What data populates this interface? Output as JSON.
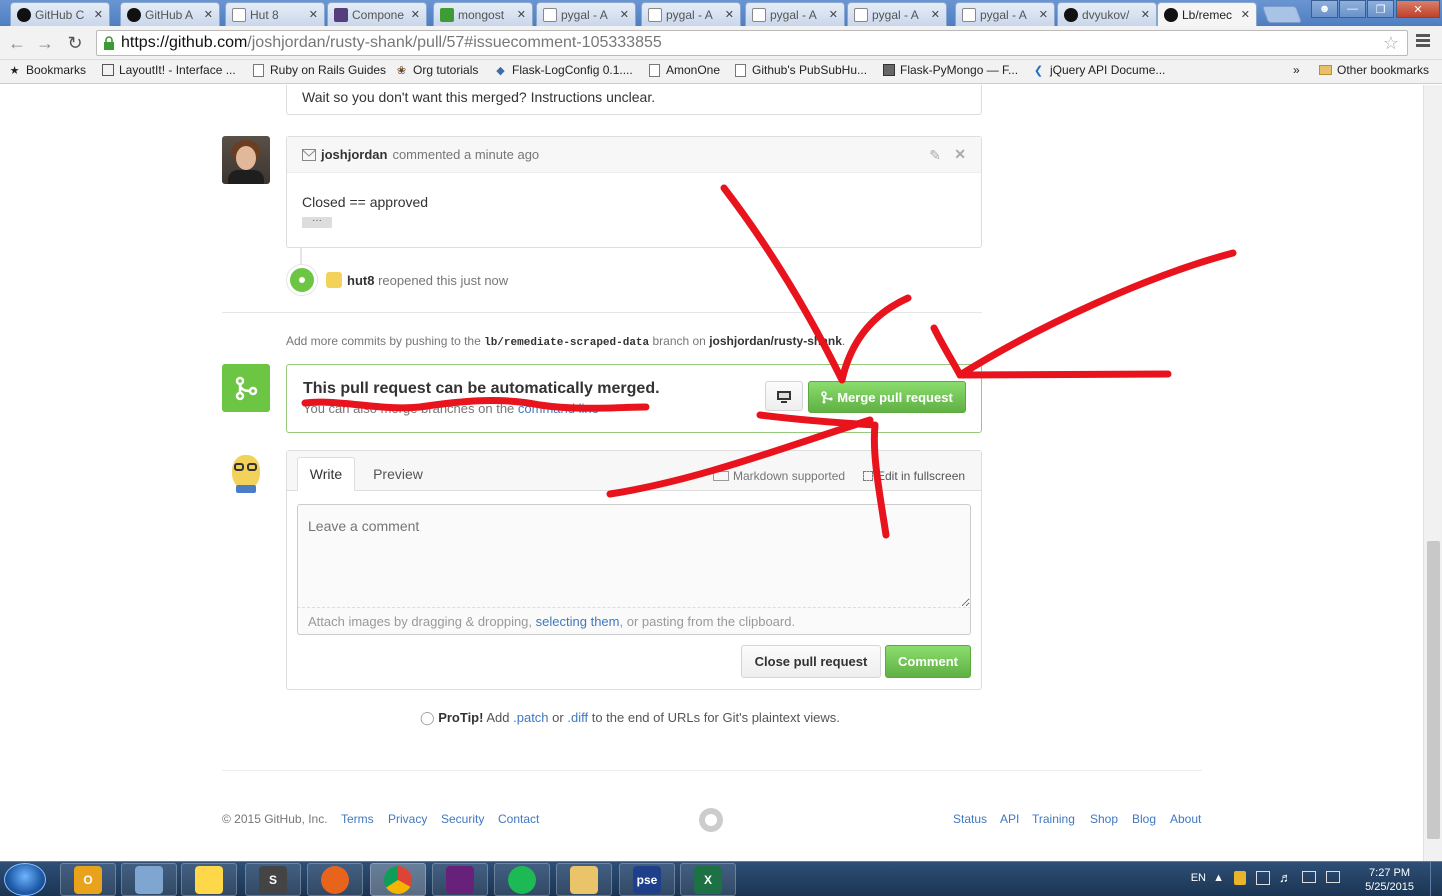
{
  "browser": {
    "tabs": [
      {
        "label": "GitHub C",
        "icon": "github-icon"
      },
      {
        "label": "GitHub A",
        "icon": "github-icon"
      },
      {
        "label": "Hut 8",
        "icon": "page-icon"
      },
      {
        "label": "Compone",
        "icon": "bootstrap-icon"
      },
      {
        "label": "mongost",
        "icon": "mongodb-icon"
      },
      {
        "label": "pygal - A",
        "icon": "page-icon"
      },
      {
        "label": "pygal - A",
        "icon": "page-icon"
      },
      {
        "label": "pygal - A",
        "icon": "page-icon"
      },
      {
        "label": "pygal - A",
        "icon": "page-icon"
      },
      {
        "label": "pygal - A",
        "icon": "page-icon"
      },
      {
        "label": "dvyukov/",
        "icon": "github-icon"
      },
      {
        "label": "Lb/remec",
        "icon": "github-icon"
      }
    ],
    "url_host": "https://github.com",
    "url_rest": "/joshjordan/rusty-shank/pull/57#issuecomment-105333855",
    "bookmarks": [
      {
        "label": "Bookmarks"
      },
      {
        "label": "LayoutIt! - Interface ..."
      },
      {
        "label": "Ruby on Rails Guides"
      },
      {
        "label": "Org tutorials"
      },
      {
        "label": "Flask-LogConfig 0.1...."
      },
      {
        "label": "AmonOne"
      },
      {
        "label": "Github's PubSubHu..."
      },
      {
        "label": "Flask-PyMongo — F..."
      },
      {
        "label": "jQuery API Docume..."
      },
      {
        "label": "»"
      },
      {
        "label": "Other bookmarks"
      }
    ]
  },
  "page": {
    "prev_comment_text": "Wait so you don't want this merged? Instructions unclear.",
    "comment": {
      "author": "joshjordan",
      "action": "commented",
      "time": "a minute ago",
      "body": "Closed == approved",
      "ellipsis": "···"
    },
    "event": {
      "user": "hut8",
      "action": "reopened this",
      "time": "just now"
    },
    "commits_hint": {
      "prefix": "Add more commits by pushing to the",
      "branch": "lb/remediate-scraped-data",
      "middle": "branch on",
      "repo": "joshjordan/rusty-shank",
      "suffix": "."
    },
    "merge": {
      "title": "This pull request can be automatically merged.",
      "subtitle_prefix": "You can also merge branches on the",
      "subtitle_link": "command line",
      "button": "Merge pull request"
    },
    "editor": {
      "tab_write": "Write",
      "tab_preview": "Preview",
      "markdown": "Markdown supported",
      "fullscreen": "Edit in fullscreen",
      "placeholder": "Leave a comment",
      "attach_prefix": "Attach images by dragging & dropping,",
      "attach_link": "selecting them",
      "attach_suffix": ", or pasting from the clipboard.",
      "close_button": "Close pull request",
      "comment_button": "Comment"
    },
    "protip": {
      "label": "ProTip!",
      "text1": "Add",
      "patch": ".patch",
      "or": "or",
      "diff": ".diff",
      "text2": "to the end of URLs for Git's plaintext views."
    },
    "footer": {
      "copyright": "© 2015 GitHub, Inc.",
      "left_links": [
        "Terms",
        "Privacy",
        "Security",
        "Contact"
      ],
      "right_links": [
        "Status",
        "API",
        "Training",
        "Shop",
        "Blog",
        "About"
      ]
    },
    "annotation_color": "#e8131c"
  },
  "taskbar": {
    "apps": [
      {
        "name": "outlook-icon",
        "glyph": "O"
      },
      {
        "name": "calculator-icon",
        "glyph": ""
      },
      {
        "name": "python-icon",
        "glyph": ""
      },
      {
        "name": "sublime-text-icon",
        "glyph": "S"
      },
      {
        "name": "firefox-icon",
        "glyph": ""
      },
      {
        "name": "chrome-icon",
        "glyph": ""
      },
      {
        "name": "visual-studio-icon",
        "glyph": ""
      },
      {
        "name": "spotify-icon",
        "glyph": ""
      },
      {
        "name": "file-explorer-icon",
        "glyph": ""
      },
      {
        "name": "pse-icon",
        "glyph": "pse"
      },
      {
        "name": "excel-icon",
        "glyph": "X"
      }
    ],
    "language": "EN",
    "time": "7:27 PM",
    "date": "5/25/2015"
  }
}
